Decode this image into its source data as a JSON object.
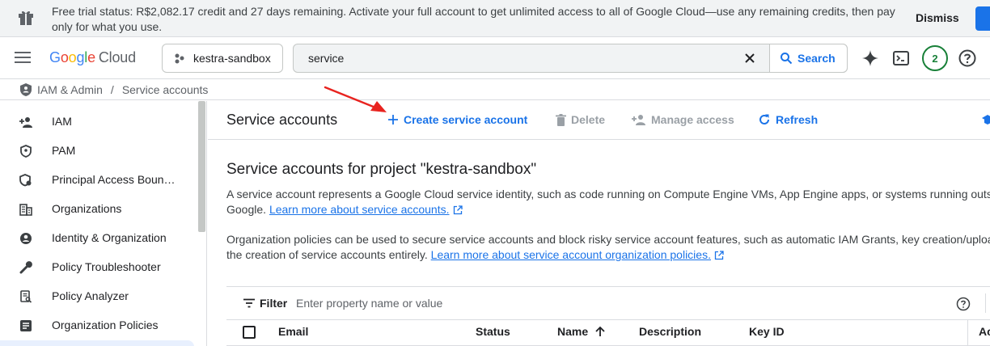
{
  "banner": {
    "text": "Free trial status: R$2,082.17 credit and 27 days remaining. Activate your full account to get unlimited access to all of Google Cloud—use any remaining credits, then pay only for what you use.",
    "dismiss_label": "Dismiss"
  },
  "topbar": {
    "logo_google": [
      "G",
      "o",
      "o",
      "g",
      "l",
      "e"
    ],
    "logo_cloud": "Cloud",
    "project": "kestra-sandbox",
    "search_value": "service",
    "search_label": "Search",
    "notifications_count": "2"
  },
  "breadcrumb": {
    "section": "IAM & Admin",
    "separator": "/",
    "page": "Service accounts"
  },
  "sidebar": {
    "items": [
      {
        "label": "IAM",
        "icon": "person-add-icon"
      },
      {
        "label": "PAM",
        "icon": "shield-icon"
      },
      {
        "label": "Principal Access Boun…",
        "icon": "shield-gear-icon"
      },
      {
        "label": "Organizations",
        "icon": "building-icon"
      },
      {
        "label": "Identity & Organization",
        "icon": "account-circle-icon"
      },
      {
        "label": "Policy Troubleshooter",
        "icon": "wrench-icon"
      },
      {
        "label": "Policy Analyzer",
        "icon": "document-search-icon"
      },
      {
        "label": "Organization Policies",
        "icon": "list-box-icon"
      }
    ]
  },
  "toolbar": {
    "title": "Service accounts",
    "create_label": "Create service account",
    "delete_label": "Delete",
    "manage_label": "Manage access",
    "refresh_label": "Refresh"
  },
  "content": {
    "heading": "Service accounts for project \"kestra-sandbox\"",
    "para1_line1": "A service account represents a Google Cloud service identity, such as code running on Compute Engine VMs, App Engine apps, or systems running outsid",
    "para1_line2": "Google.",
    "para1_link": "Learn more about service accounts.",
    "para2_line1": "Organization policies can be used to secure service accounts and block risky service account features, such as automatic IAM Grants, key creation/uploa",
    "para2_line2": "the creation of service accounts entirely.",
    "para2_link": "Learn more about service account organization policies."
  },
  "filter": {
    "label": "Filter",
    "placeholder": "Enter property name or value"
  },
  "table": {
    "columns": [
      "Email",
      "Status",
      "Name",
      "Description",
      "Key ID",
      "Ac"
    ]
  },
  "colors": {
    "accent": "#1a73e8",
    "annotation_arrow": "#e8231f",
    "notification": "#188038"
  }
}
